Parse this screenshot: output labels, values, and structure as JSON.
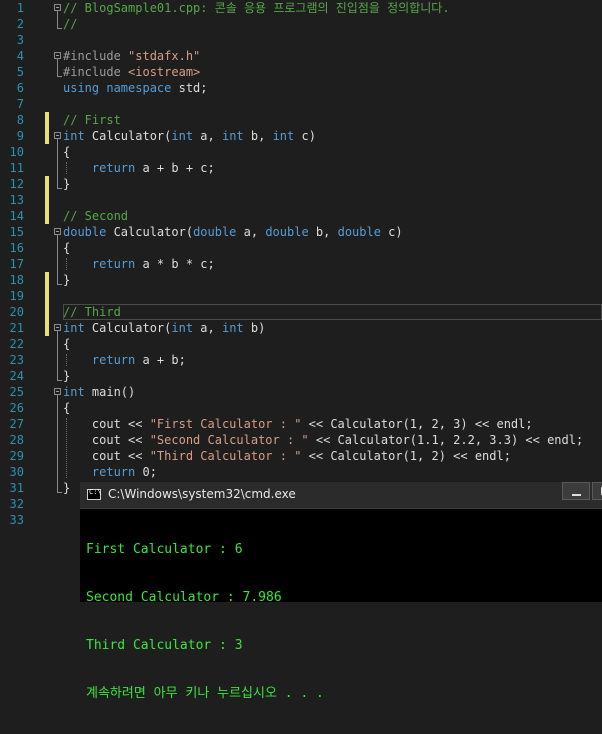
{
  "editor": {
    "lines": [
      {
        "n": "1",
        "parts": [
          {
            "t": "// BlogSample01.cpp: 콘솔 응용 프로그램의 진입점을 정의합니다.",
            "c": "cm"
          }
        ]
      },
      {
        "n": "2",
        "parts": [
          {
            "t": "//",
            "c": "cm"
          }
        ]
      },
      {
        "n": "3",
        "parts": []
      },
      {
        "n": "4",
        "parts": [
          {
            "t": "#include ",
            "c": "pp"
          },
          {
            "t": "\"stdafx.h\"",
            "c": "inc"
          }
        ]
      },
      {
        "n": "5",
        "parts": [
          {
            "t": "#include ",
            "c": "pp"
          },
          {
            "t": "<iostream>",
            "c": "inc"
          }
        ]
      },
      {
        "n": "6",
        "parts": [
          {
            "t": "using namespace ",
            "c": "kw"
          },
          {
            "t": "std;",
            "c": ""
          }
        ]
      },
      {
        "n": "7",
        "parts": []
      },
      {
        "n": "8",
        "parts": [
          {
            "t": "// First",
            "c": "cm"
          }
        ]
      },
      {
        "n": "9",
        "parts": [
          {
            "t": "int",
            "c": "kw"
          },
          {
            "t": " Calculator(",
            "c": ""
          },
          {
            "t": "int",
            "c": "kw"
          },
          {
            "t": " a, ",
            "c": ""
          },
          {
            "t": "int",
            "c": "kw"
          },
          {
            "t": " b, ",
            "c": ""
          },
          {
            "t": "int",
            "c": "kw"
          },
          {
            "t": " c)",
            "c": ""
          }
        ]
      },
      {
        "n": "10",
        "parts": [
          {
            "t": "{",
            "c": ""
          }
        ]
      },
      {
        "n": "11",
        "parts": [
          {
            "t": "    return",
            "c": "kw"
          },
          {
            "t": " a + b + c;",
            "c": ""
          }
        ]
      },
      {
        "n": "12",
        "parts": [
          {
            "t": "}",
            "c": ""
          }
        ]
      },
      {
        "n": "13",
        "parts": []
      },
      {
        "n": "14",
        "parts": [
          {
            "t": "// Second",
            "c": "cm"
          }
        ]
      },
      {
        "n": "15",
        "parts": [
          {
            "t": "double",
            "c": "kw"
          },
          {
            "t": " Calculator(",
            "c": ""
          },
          {
            "t": "double",
            "c": "kw"
          },
          {
            "t": " a, ",
            "c": ""
          },
          {
            "t": "double",
            "c": "kw"
          },
          {
            "t": " b, ",
            "c": ""
          },
          {
            "t": "double",
            "c": "kw"
          },
          {
            "t": " c)",
            "c": ""
          }
        ]
      },
      {
        "n": "16",
        "parts": [
          {
            "t": "{",
            "c": ""
          }
        ]
      },
      {
        "n": "17",
        "parts": [
          {
            "t": "    return",
            "c": "kw"
          },
          {
            "t": " a * b * c;",
            "c": ""
          }
        ]
      },
      {
        "n": "18",
        "parts": [
          {
            "t": "}",
            "c": ""
          }
        ]
      },
      {
        "n": "19",
        "parts": []
      },
      {
        "n": "20",
        "parts": [
          {
            "t": "// Third",
            "c": "cm"
          }
        ]
      },
      {
        "n": "21",
        "parts": [
          {
            "t": "int",
            "c": "kw"
          },
          {
            "t": " Calculator(",
            "c": ""
          },
          {
            "t": "int",
            "c": "kw"
          },
          {
            "t": " a, ",
            "c": ""
          },
          {
            "t": "int",
            "c": "kw"
          },
          {
            "t": " b)",
            "c": ""
          }
        ]
      },
      {
        "n": "22",
        "parts": [
          {
            "t": "{",
            "c": ""
          }
        ]
      },
      {
        "n": "23",
        "parts": [
          {
            "t": "    return",
            "c": "kw"
          },
          {
            "t": " a + b;",
            "c": ""
          }
        ]
      },
      {
        "n": "24",
        "parts": [
          {
            "t": "}",
            "c": ""
          }
        ]
      },
      {
        "n": "25",
        "parts": [
          {
            "t": "int",
            "c": "kw"
          },
          {
            "t": " main()",
            "c": ""
          }
        ]
      },
      {
        "n": "26",
        "parts": [
          {
            "t": "{",
            "c": ""
          }
        ]
      },
      {
        "n": "27",
        "parts": [
          {
            "t": "    cout << ",
            "c": ""
          },
          {
            "t": "\"First Calculator : \"",
            "c": "str"
          },
          {
            "t": " << Calculator(1, 2, 3) << endl;",
            "c": ""
          }
        ]
      },
      {
        "n": "28",
        "parts": [
          {
            "t": "    cout << ",
            "c": ""
          },
          {
            "t": "\"Second Calculator : \"",
            "c": "str"
          },
          {
            "t": " << Calculator(1.1, 2.2, 3.3) << endl;",
            "c": ""
          }
        ]
      },
      {
        "n": "29",
        "parts": [
          {
            "t": "    cout << ",
            "c": ""
          },
          {
            "t": "\"Third Calculator : \"",
            "c": "str"
          },
          {
            "t": " << Calculator(1, 2) << endl;",
            "c": ""
          }
        ]
      },
      {
        "n": "30",
        "parts": [
          {
            "t": "    return",
            "c": "kw"
          },
          {
            "t": " 0;",
            "c": ""
          }
        ]
      },
      {
        "n": "31",
        "parts": [
          {
            "t": "}",
            "c": ""
          }
        ]
      },
      {
        "n": "32",
        "parts": []
      },
      {
        "n": "33",
        "parts": []
      }
    ]
  },
  "console": {
    "title": "C:\\Windows\\system32\\cmd.exe",
    "lines": [
      "First Calculator : 6",
      "Second Calculator : 7.986",
      "Third Calculator : 3",
      "계속하려면 아무 키나 누르십시오 . . ."
    ]
  },
  "colors": {
    "background": "#1e1e1e",
    "keyword": "#569cd6",
    "comment": "#57a64a",
    "string": "#d69d85",
    "line_number": "#2b91af",
    "console_text": "#39e639"
  }
}
